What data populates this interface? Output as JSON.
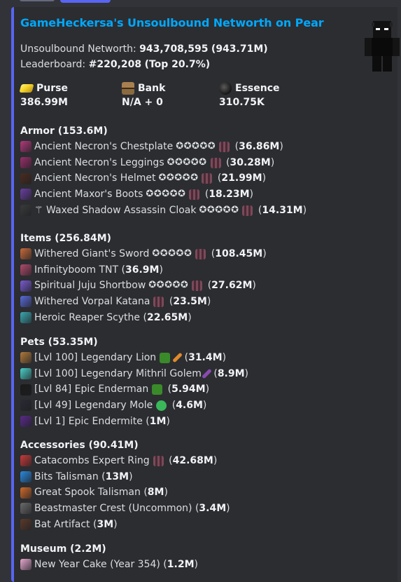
{
  "title": "GameHeckersa's Unsoulbound Networth on Pear",
  "networth": {
    "label": "Unsoulbound Networth:",
    "value": "943,708,595",
    "short": "(943.71M)"
  },
  "leaderboard": {
    "label": "Leaderboard:",
    "rank": "#220,208",
    "top": "(Top 20.7%)"
  },
  "fields": [
    {
      "name": "Purse",
      "value": "386.99M",
      "icon": "gold-ingot-icon",
      "color": "#f5d327"
    },
    {
      "name": "Bank",
      "value": "N/A + 0",
      "icon": "chest-icon",
      "color": "#8b6a3e"
    },
    {
      "name": "Essence",
      "value": "310.75K",
      "icon": "wither-essence-icon",
      "color": "#2d2d2d"
    }
  ],
  "sections": [
    {
      "title": "Armor (153.6M)",
      "items": [
        {
          "name": "Ancient Necron's Chestplate",
          "stars": "✪✪✪✪✪",
          "rec": true,
          "value": "36.86M",
          "icon": "chestplate-icon",
          "color": "#b03a7a"
        },
        {
          "name": "Ancient Necron's Leggings",
          "stars": "✪✪✪✪✪",
          "rec": true,
          "value": "30.28M",
          "icon": "leggings-icon",
          "color": "#9a2f6a"
        },
        {
          "name": "Ancient Necron's Helmet",
          "stars": "✪✪✪✪✪",
          "rec": true,
          "value": "21.99M",
          "icon": "helmet-icon",
          "color": "#4a2c1f"
        },
        {
          "name": "Ancient Maxor's Boots",
          "stars": "✪✪✪✪✪",
          "rec": true,
          "value": "18.23M",
          "icon": "boots-icon",
          "color": "#6a3fa0"
        },
        {
          "name": "⚚ Waxed Shadow Assassin Cloak",
          "stars": "✪✪✪✪✪",
          "rec": true,
          "value": "14.31M",
          "icon": "cloak-icon",
          "color": "#3a3a3a"
        }
      ]
    },
    {
      "title": "Items (256.84M)",
      "items": [
        {
          "name": "Withered Giant's Sword",
          "stars": "✪✪✪✪✪",
          "rec": true,
          "value": "108.45M",
          "icon": "sword-icon",
          "color": "#c86a3a"
        },
        {
          "name": "Infinityboom TNT",
          "stars": "",
          "rec": false,
          "value": "36.9M",
          "icon": "tnt-icon",
          "color": "#b04a6a"
        },
        {
          "name": "Spiritual Juju Shortbow",
          "stars": "✪✪✪✪✪",
          "rec": true,
          "value": "27.62M",
          "icon": "bow-icon",
          "color": "#7a5ad0"
        },
        {
          "name": "Withered Vorpal Katana",
          "stars": "",
          "rec": true,
          "value": "23.5M",
          "icon": "katana-icon",
          "color": "#5a6ad8"
        },
        {
          "name": "Heroic Reaper Scythe",
          "stars": "",
          "rec": false,
          "value": "22.65M",
          "icon": "scythe-icon",
          "color": "#3aa8b0"
        }
      ]
    },
    {
      "title": "Pets (53.35M)",
      "items": [
        {
          "name": "[Lvl 100] Legendary Lion",
          "stars": "",
          "rec": false,
          "extra": [
            "block-icon",
            "carrot-icon"
          ],
          "value": "31.4M",
          "icon": "lion-icon",
          "color": "#b07a3a"
        },
        {
          "name": "[Lvl 100] Legendary Mithril Golem",
          "stars": "",
          "rec": false,
          "extra": [
            "pickaxe-icon"
          ],
          "value": "8.9M",
          "icon": "golem-icon",
          "color": "#4ad0c8"
        },
        {
          "name": "[Lvl 84] Epic Enderman",
          "stars": "",
          "rec": false,
          "extra": [
            "block-icon"
          ],
          "value": "5.94M",
          "icon": "enderman-icon",
          "color": "#1a1a1a"
        },
        {
          "name": "[Lvl 49] Legendary Mole",
          "stars": "",
          "rec": false,
          "extra": [
            "clover-icon"
          ],
          "value": "4.6M",
          "icon": "mole-icon",
          "color": "#2a2a34"
        },
        {
          "name": "[Lvl 1] Epic Endermite",
          "stars": "",
          "rec": false,
          "extra": [],
          "value": "1M",
          "icon": "endermite-icon",
          "color": "#5a2a8a"
        }
      ]
    },
    {
      "title": "Accessories (90.41M)",
      "items": [
        {
          "name": "Catacombs Expert Ring",
          "stars": "",
          "rec": true,
          "value": "42.68M",
          "icon": "ring-icon",
          "color": "#c83a3a"
        },
        {
          "name": "Bits Talisman",
          "stars": "",
          "rec": false,
          "value": "13M",
          "icon": "bits-icon",
          "color": "#2a8ae0"
        },
        {
          "name": "Great Spook Talisman",
          "stars": "",
          "rec": false,
          "value": "8M",
          "icon": "spook-icon",
          "color": "#d06a2a"
        },
        {
          "name": "Beastmaster Crest (Uncommon)",
          "stars": "",
          "rec": false,
          "value": "3.4M",
          "icon": "crest-icon",
          "color": "#6a6a6a"
        },
        {
          "name": "Bat Artifact",
          "stars": "",
          "rec": false,
          "value": "3M",
          "icon": "bat-icon",
          "color": "#5a3a2a"
        }
      ]
    },
    {
      "title": "Museum (2.2M)",
      "items": [
        {
          "name": "New Year Cake (Year 354)",
          "stars": "",
          "rec": false,
          "value": "1.2M",
          "icon": "cake-icon",
          "color": "#e8a8d0"
        }
      ]
    }
  ],
  "colors": {
    "accent": "#5865f2",
    "link": "#00a8fc",
    "embed_bg": "#2b2d31",
    "page_bg": "#313338"
  }
}
